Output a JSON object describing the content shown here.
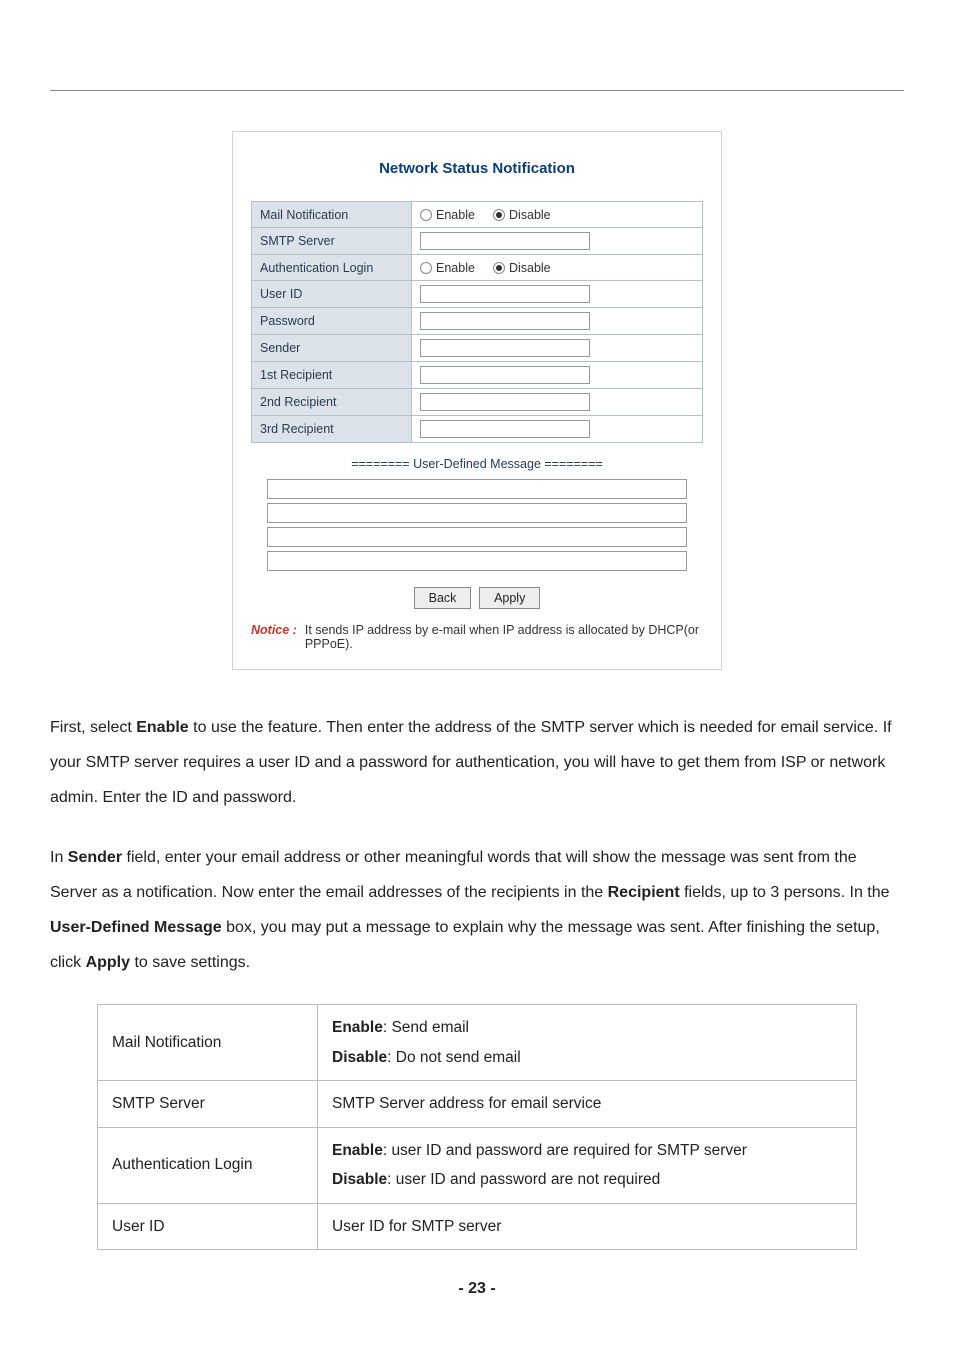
{
  "dialog": {
    "title": "Network Status Notification",
    "rows": {
      "mail_notification": "Mail Notification",
      "smtp_server": "SMTP Server",
      "auth_login": "Authentication Login",
      "user_id": "User ID",
      "password": "Password",
      "sender": "Sender",
      "r1": "1st Recipient",
      "r2": "2nd Recipient",
      "r3": "3rd Recipient"
    },
    "radio": {
      "enable": "Enable",
      "disable": "Disable"
    },
    "udm_title": "======== User-Defined Message ========",
    "buttons": {
      "back": "Back",
      "apply": "Apply"
    },
    "notice_label": "Notice :",
    "notice_text": "It sends IP address by e-mail when IP address is allocated by DHCP(or PPPoE)."
  },
  "para1": {
    "t1": "First, select ",
    "b1": "Enable",
    "t2": " to use the feature. Then enter the address of the SMTP server which is needed for email service. If your SMTP server requires a user ID and a password for authentication, you will have to get them from ISP or network admin. Enter the ID and password."
  },
  "para2": {
    "t1": "In ",
    "b1": "Sender",
    "t2": " field, enter your email address or other meaningful words that will show the message was sent from the Server   as a notification. Now enter the email addresses of the recipients in the ",
    "b2": "Recipient",
    "t3": " fields, up to 3 persons. In the ",
    "b3": "User-Defined Message",
    "t4": " box, you may put a message to explain why the message was sent. After finishing the setup, click ",
    "b4": "Apply",
    "t5": " to save settings."
  },
  "info_table": {
    "r1k": "Mail Notification",
    "r1v1b": "Enable",
    "r1v1": ": Send email",
    "r1v2b": "Disable",
    "r1v2": ": Do not send email",
    "r2k": "SMTP Server",
    "r2v": "SMTP Server address for email service",
    "r3k": "Authentication Login",
    "r3v1b": "Enable",
    "r3v1": ": user ID and password are required for SMTP server",
    "r3v2b": "Disable",
    "r3v2": ": user ID and password are not required",
    "r4k": "User ID",
    "r4v": "User ID for SMTP server"
  },
  "page_num": "- 23 -"
}
